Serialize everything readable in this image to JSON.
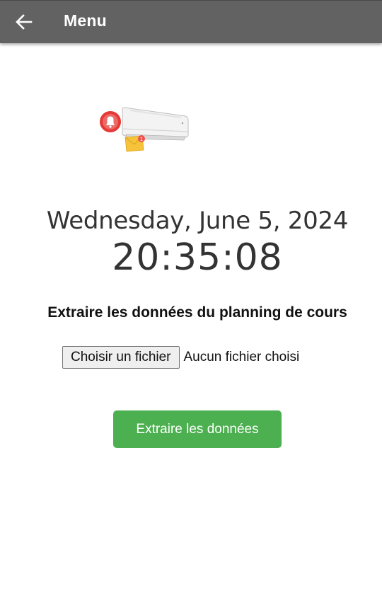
{
  "appbar": {
    "title": "Menu",
    "back_icon": "arrow-left-icon",
    "background_color": "#626262"
  },
  "illustration": {
    "icon": "air-conditioner-notification-icon",
    "badge_count": "1"
  },
  "clock": {
    "date": "Wednesday, June 5, 2024",
    "time": "20:35:08"
  },
  "extract": {
    "heading": "Extraire les données du planning de cours",
    "file_button_label": "Choisir un fichier",
    "file_status": "Aucun fichier choisi",
    "submit_label": "Extraire les données",
    "submit_color": "#4caf50"
  }
}
